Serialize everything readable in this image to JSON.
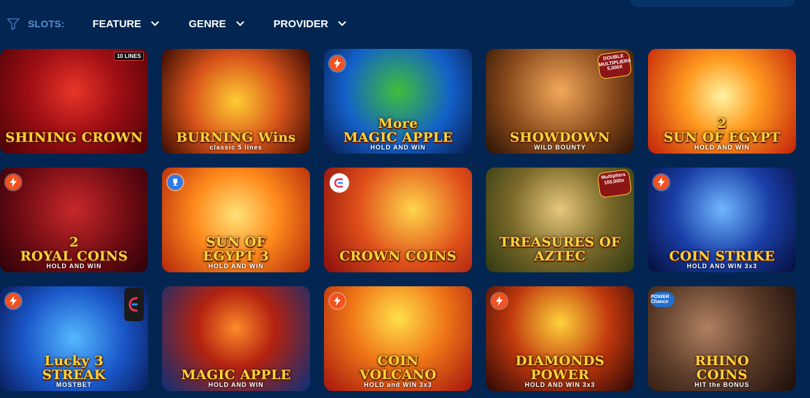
{
  "filters": {
    "slots_label": "SLOTS:",
    "items": [
      {
        "label": "FEATURE"
      },
      {
        "label": "GENRE"
      },
      {
        "label": "PROVIDER"
      }
    ],
    "icon": "filter-icon",
    "chevron_icon": "chevron-down-icon"
  },
  "colors": {
    "background": "#022651",
    "accent_label": "#5d8fd6",
    "bolt_badge": "#f4511e",
    "trophy_badge": "#2f7be5"
  },
  "games": [
    {
      "title": "SHINING CROWN",
      "sub": "",
      "badge": "10 LINES",
      "badge_type": "lines",
      "theme": "crown"
    },
    {
      "title": "BURNING Wins",
      "sub": "classic 5 lines",
      "badge": "",
      "badge_type": "none",
      "theme": "burning"
    },
    {
      "title": "More\nMAGIC APPLE",
      "sub": "HOLD AND WIN",
      "badge": "",
      "badge_type": "bolt",
      "theme": "moreapple"
    },
    {
      "title": "SHOWDOWN",
      "sub": "WILD BOUNTY",
      "badge": "DOUBLE MULTIPLIERS 5,000X",
      "badge_type": "mult",
      "theme": "showdown"
    },
    {
      "title": "2\nSUN OF EGYPT",
      "sub": "HOLD AND WIN",
      "badge": "",
      "badge_type": "none",
      "theme": "sun2"
    },
    {
      "title": "2\nROYAL COINS",
      "sub": "HOLD AND WIN",
      "badge": "",
      "badge_type": "bolt",
      "theme": "royal"
    },
    {
      "title": "SUN OF\nEGYPT 3",
      "sub": "HOLD AND WIN",
      "badge": "",
      "badge_type": "trophy",
      "theme": "sun3"
    },
    {
      "title": "CROWN COINS",
      "sub": "",
      "badge": "",
      "badge_type": "circle-e",
      "theme": "crowncoins"
    },
    {
      "title": "TREASURES OF\nAZTEC",
      "sub": "",
      "badge": "Multipliers 100,000x",
      "badge_type": "mult",
      "theme": "aztec"
    },
    {
      "title": "COIN STRIKE",
      "sub": "HOLD AND WIN 3x3",
      "badge": "",
      "badge_type": "bolt",
      "theme": "coinstrike"
    },
    {
      "title": "Lucky 3\nSTREAK",
      "sub": "MOSTBET",
      "badge": "",
      "badge_type": "bolt-e",
      "theme": "lucky"
    },
    {
      "title": "MAGIC APPLE",
      "sub": "HOLD AND WIN",
      "badge": "",
      "badge_type": "none",
      "theme": "magicapple"
    },
    {
      "title": "COIN\nVOLCANO",
      "sub": "HOLD and WIN 3x3",
      "badge": "",
      "badge_type": "bolt",
      "theme": "volcano"
    },
    {
      "title": "DIAMONDS\nPOWER",
      "sub": "HOLD AND WIN 3x3",
      "badge": "",
      "badge_type": "bolt",
      "theme": "diamonds"
    },
    {
      "title": "RHINO\nCOINS",
      "sub": "HIT the BONUS",
      "badge": "POWER Chance",
      "badge_type": "power",
      "theme": "rhino"
    }
  ]
}
